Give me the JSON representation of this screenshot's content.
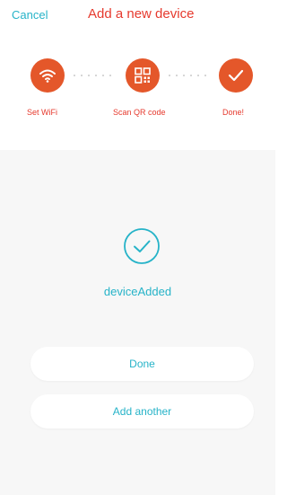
{
  "header": {
    "cancel_label": "Cancel",
    "title": "Add a new device"
  },
  "steps": [
    {
      "label": "Set WiFi",
      "icon": "wifi-icon"
    },
    {
      "label": "Scan QR code",
      "icon": "qr-code-icon"
    },
    {
      "label": "Done!",
      "icon": "checkmark-icon"
    }
  ],
  "result": {
    "status_text": "deviceAdded",
    "icon": "success-check-icon"
  },
  "actions": {
    "done_label": "Done",
    "add_another_label": "Add another"
  },
  "colors": {
    "accent": "#26b3c8",
    "brand_red": "#e63a2e",
    "step_orange": "#e4572a"
  }
}
